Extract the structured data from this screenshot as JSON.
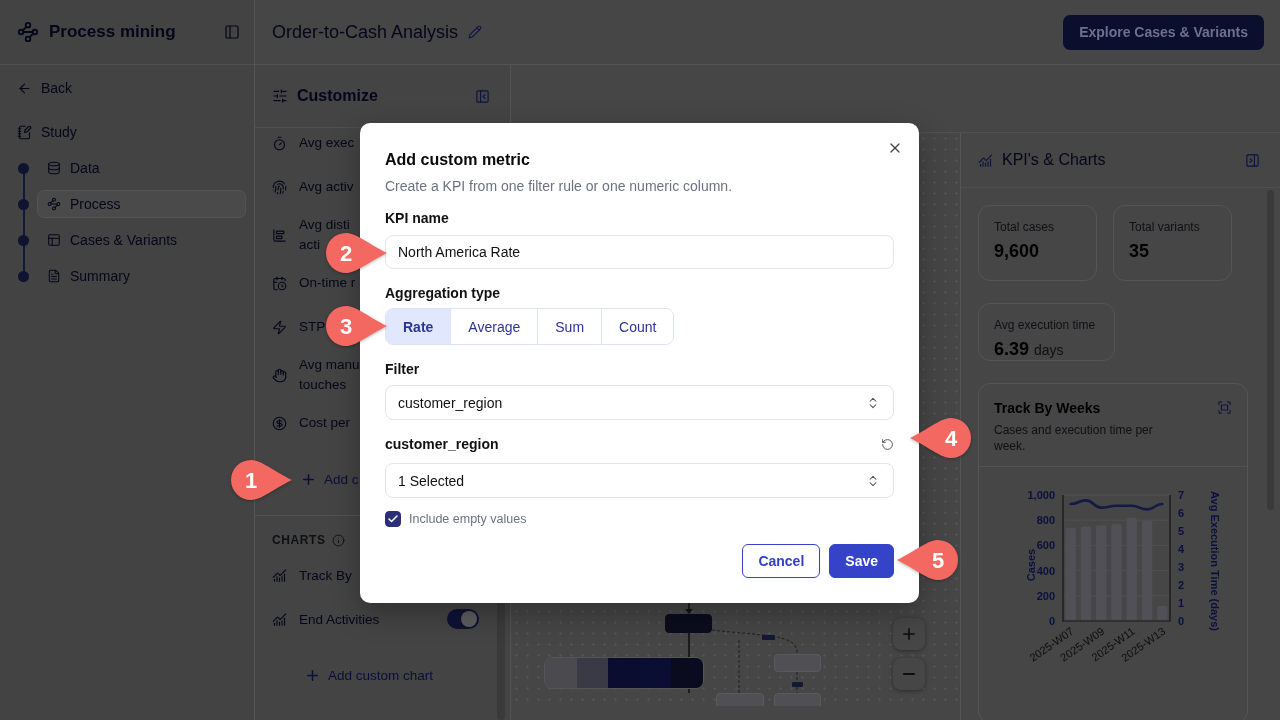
{
  "sidebar": {
    "app_name": "Process mining",
    "back": "Back",
    "study": "Study",
    "steps": [
      {
        "label": "Data",
        "selected": false
      },
      {
        "label": "Process",
        "selected": true
      },
      {
        "label": "Cases & Variants",
        "selected": false
      },
      {
        "label": "Summary",
        "selected": false
      }
    ]
  },
  "header": {
    "title": "Order-to-Cash Analysis",
    "action": "Explore Cases & Variants"
  },
  "customize": {
    "title": "Customize",
    "metrics": [
      {
        "lines": [
          "Avg exec"
        ]
      },
      {
        "lines": [
          "Avg activ"
        ]
      },
      {
        "lines": [
          "Avg disti",
          "acti"
        ]
      },
      {
        "lines": [
          "On-time r"
        ]
      },
      {
        "lines": [
          "STP"
        ]
      },
      {
        "lines": [
          "Avg manu",
          "touches"
        ]
      },
      {
        "lines": [
          "Cost per"
        ]
      }
    ],
    "add_metric": "Add c",
    "charts_heading": "CHARTS",
    "charts": [
      {
        "label": "Track By"
      },
      {
        "label": "End Activities",
        "on": true
      }
    ],
    "add_chart": "Add custom chart"
  },
  "kpi_panel": {
    "title": "KPI's & Charts",
    "cards": [
      {
        "label": "Total cases",
        "value": "9,600"
      },
      {
        "label": "Total variants",
        "value": "35"
      },
      {
        "label": "Avg execution time",
        "value": "6.39",
        "unit": "days"
      }
    ],
    "chart_card": {
      "title": "Track By Weeks",
      "subtitle": "Cases and execution time per week.",
      "layers": [
        {
          "chart_data": {
            "type": "bar",
            "ylabel": "Cases",
            "categories": [
              "2025-W07",
              null,
              "2025-W09",
              null,
              "2025-W11",
              null,
              "2025-W13"
            ],
            "ylim": [
              0,
              1000
            ],
            "yticks": [
              0,
              200,
              400,
              600,
              800,
              {
                "value": 1000,
                "label": "1,000"
              }
            ],
            "grid": true,
            "values": [
              740,
              750,
              760,
              770,
              820,
              800,
              120
            ]
          }
        },
        {
          "chart_data": {
            "type": "line",
            "ylabel": "Avg Execution Time (days)",
            "categories": [
              null,
              null,
              null,
              null,
              null,
              null,
              null
            ],
            "ylim": [
              0,
              7
            ],
            "yticks": [
              0,
              1,
              2,
              3,
              4,
              5,
              6,
              7
            ],
            "values": [
              6.5,
              6.7,
              6.3,
              6.4,
              6.4,
              6.2,
              6.5
            ]
          }
        }
      ]
    }
  },
  "dialog": {
    "title": "Add custom metric",
    "description": "Create a KPI from one filter rule or one numeric column.",
    "name_field": {
      "label": "KPI name",
      "value": "North America Rate"
    },
    "aggregation": {
      "label": "Aggregation type",
      "options": [
        {
          "label": "Rate",
          "selected": true
        },
        {
          "label": "Average",
          "selected": false
        },
        {
          "label": "Sum",
          "selected": false
        },
        {
          "label": "Count",
          "selected": false
        }
      ]
    },
    "filter_field": {
      "label": "Filter",
      "value": "customer_region"
    },
    "values_field": {
      "label": "customer_region",
      "value": "1 Selected"
    },
    "include_empty": {
      "label": "Include empty values",
      "checked": true
    },
    "buttons": [
      {
        "label": "Cancel",
        "kind": "secondary"
      },
      {
        "label": "Save",
        "kind": "primary"
      }
    ]
  },
  "callouts": [
    {
      "number": "1",
      "kind": "right"
    },
    {
      "number": "2",
      "kind": "right"
    },
    {
      "number": "3",
      "kind": "right"
    },
    {
      "number": "4",
      "kind": "left"
    },
    {
      "number": "5",
      "kind": "left"
    }
  ]
}
